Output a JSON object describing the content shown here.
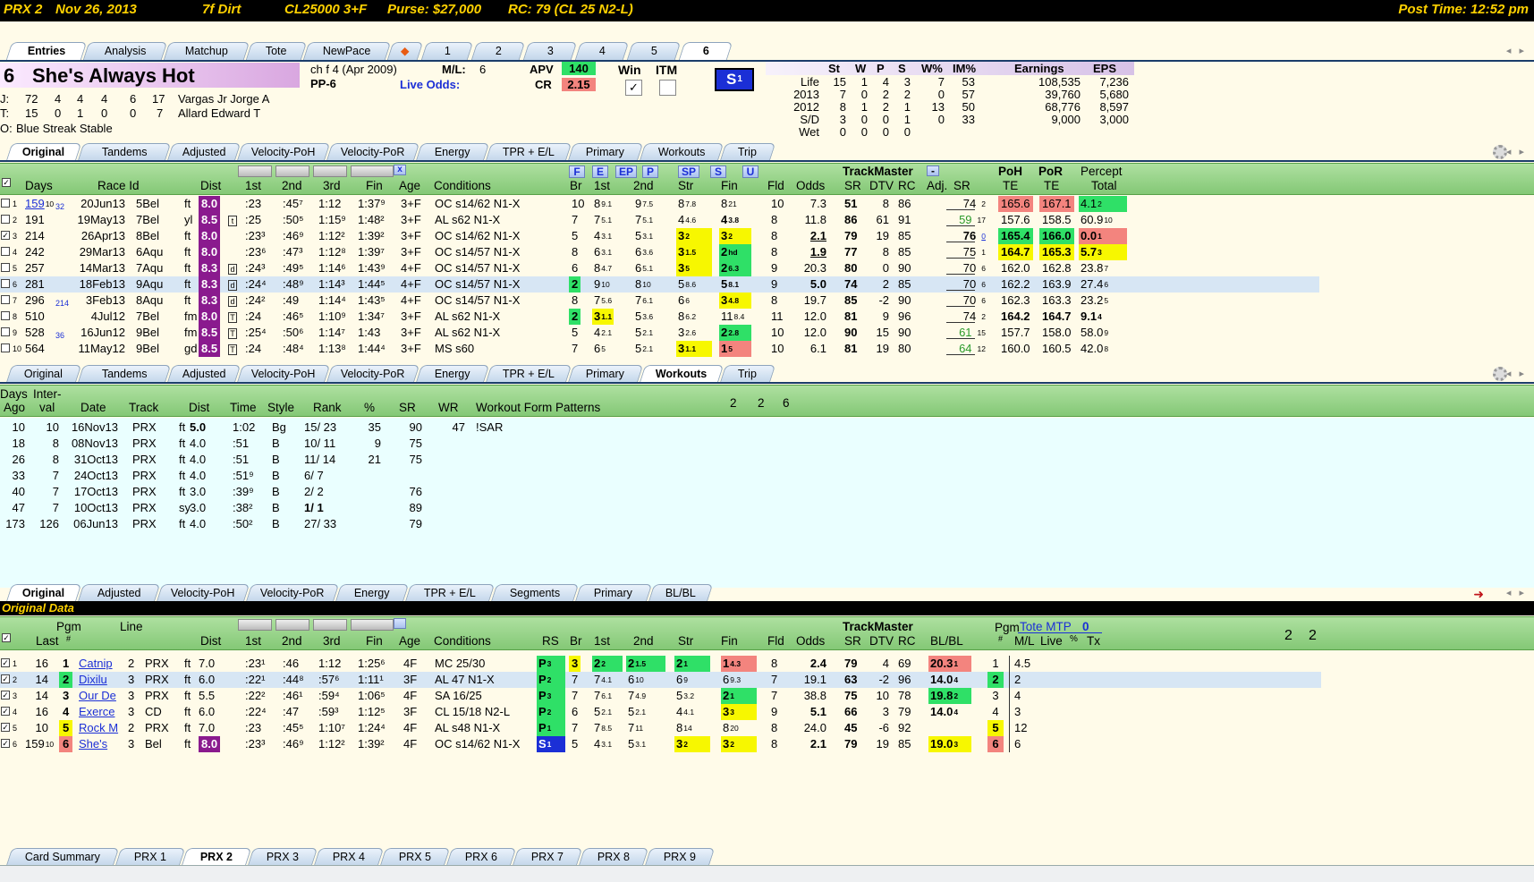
{
  "race_header": {
    "track": "PRX 2",
    "date": "Nov 26, 2013",
    "distance_surface": "7f Dirt",
    "class": "CL25000 3+F",
    "purse": "Purse: $27,000",
    "rc": "RC: 79 (CL 25 N2-L)",
    "post_time": "Post Time: 12:52 pm"
  },
  "top_tabs": [
    "Entries",
    "Analysis",
    "Matchup",
    "Tote",
    "NewPace",
    "1",
    "2",
    "3",
    "4",
    "5",
    "6"
  ],
  "horse": {
    "number": "6",
    "name": "She's Always Hot",
    "desc": "ch f 4  (Apr 2009)",
    "pp": "PP-6",
    "ml_label": "M/L:",
    "ml": "6",
    "live_odds_label": "Live Odds:",
    "apv_label": "APV",
    "apv": "140",
    "cr_label": "CR",
    "cr": "2.15",
    "win_label": "Win",
    "itm_label": "ITM",
    "badge": "S",
    "badge_sup": "1",
    "jockey": {
      "label": "J:",
      "stats": [
        "72",
        "4",
        "4",
        "4",
        "6",
        "17"
      ],
      "name": "Vargas Jr Jorge A"
    },
    "trainer": {
      "label": "T:",
      "stats": [
        "15",
        "0",
        "1",
        "0",
        "0",
        "7"
      ],
      "name": "Allard Edward T"
    },
    "owner": {
      "label": "O:",
      "name": "Blue Streak Stable"
    }
  },
  "record": {
    "headers": [
      "St",
      "W",
      "P",
      "S",
      "W%",
      "IM%",
      "Earnings",
      "EPS"
    ],
    "rows": [
      [
        "Life",
        "15",
        "1",
        "4",
        "3",
        "7",
        "53",
        "108,535",
        "7,236"
      ],
      [
        "2013",
        "7",
        "0",
        "2",
        "2",
        "0",
        "57",
        "39,760",
        "5,680"
      ],
      [
        "2012",
        "8",
        "1",
        "2",
        "1",
        "13",
        "50",
        "68,776",
        "8,597"
      ],
      [
        "S/D",
        "3",
        "0",
        "0",
        "1",
        "0",
        "33",
        "9,000",
        "3,000"
      ],
      [
        "Wet",
        "0",
        "0",
        "0",
        "0",
        "",
        "",
        "",
        ""
      ]
    ]
  },
  "pp_tabs": [
    "Original",
    "Tandems",
    "Adjusted",
    "Velocity-PoH",
    "Velocity-PoR",
    "Energy",
    "TPR + E/L",
    "Primary",
    "Workouts",
    "Trip"
  ],
  "pp_headers": {
    "days": "Days",
    "raceid": "Race Id",
    "dist": "Dist",
    "c1": "1st",
    "c2": "2nd",
    "c3": "3rd",
    "fin": "Fin",
    "age": "Age",
    "cond": "Conditions",
    "br": "Br",
    "p1": "1st",
    "p2": "2nd",
    "str": "Str",
    "pfin": "Fin",
    "fld": "Fld",
    "odds": "Odds",
    "tm": "TrackMaster",
    "sr": "SR",
    "dtv": "DTV",
    "rc": "RC",
    "adj": "Adj.",
    "adjsr": "SR",
    "poh": "PoH",
    "por": "PoR",
    "te1": "TE",
    "te2": "TE",
    "percept": "Percept",
    "total": "Total",
    "btn_f": "F",
    "btn_e": "E",
    "btn_ep": "EP",
    "btn_p": "P",
    "btn_sp": "SP",
    "btn_s": "S",
    "btn_u": "U",
    "x": "x",
    "minus": "-"
  },
  "pp_rows": [
    {
      "n": "1",
      "days": "159",
      "days_sup": "10",
      "days2": "32",
      "date": "20Jun13",
      "race": "5Bel",
      "surf": "ft",
      "dist": "8.0",
      "mark": "",
      "f1": ":23",
      "f2": ":45⁷",
      "f3": "1:12",
      "ff": "1:37⁹",
      "age": "3+F",
      "cond": "OC s14/62 N1-X",
      "br": "10",
      "p1": "8",
      "p1s": "9.1",
      "p2": "9",
      "p2s": "7.5",
      "str": "8",
      "strs": "7.8",
      "fin": "8",
      "fins": "21",
      "fld": "10",
      "odds": "7.3",
      "sr": "51",
      "dtv": "8",
      "rc": "86",
      "adj": "74",
      "adjs": "2",
      "poh": "165.6",
      "por": "167.1",
      "pct": "4.1",
      "pcts": "2"
    },
    {
      "n": "2",
      "days": "191",
      "days_sup": "",
      "days2": "",
      "date": "19May13",
      "race": "7Bel",
      "surf": "yl",
      "dist": "8.5",
      "mark": "t",
      "f1": ":25",
      "f2": ":50⁵",
      "f3": "1:15⁹",
      "ff": "1:48²",
      "age": "3+F",
      "cond": "AL s62 N1-X",
      "br": "7",
      "p1": "7",
      "p1s": "5.1",
      "p2": "7",
      "p2s": "5.1",
      "str": "4",
      "strs": "4.6",
      "fin": "4",
      "fins": "3.8",
      "fld": "8",
      "odds": "11.8",
      "sr": "86",
      "dtv": "61",
      "rc": "91",
      "adj": "59",
      "adjs": "17",
      "poh": "157.6",
      "por": "158.5",
      "pct": "60.9",
      "pcts": "10"
    },
    {
      "n": "3",
      "days": "214",
      "days_sup": "",
      "days2": "",
      "date": "26Apr13",
      "race": "8Bel",
      "surf": "ft",
      "dist": "8.0",
      "mark": "",
      "f1": ":23³",
      "f2": ":46⁹",
      "f3": "1:12²",
      "ff": "1:39²",
      "age": "3+F",
      "cond": "OC s14/62 N1-X",
      "br": "5",
      "p1": "4",
      "p1s": "3.1",
      "p2": "5",
      "p2s": "3.1",
      "str": "3",
      "strs": "2",
      "fin": "3",
      "fins": "2",
      "fld": "8",
      "odds": "2.1",
      "sr": "79",
      "dtv": "19",
      "rc": "85",
      "adj": "76",
      "adjs": "0",
      "poh": "165.4",
      "por": "166.0",
      "pct": "0.0",
      "pcts": "1"
    },
    {
      "n": "4",
      "days": "242",
      "days_sup": "",
      "days2": "",
      "date": "29Mar13",
      "race": "6Aqu",
      "surf": "ft",
      "dist": "8.0",
      "mark": "",
      "f1": ":23⁶",
      "f2": ":47³",
      "f3": "1:12⁸",
      "ff": "1:39⁷",
      "age": "3+F",
      "cond": "OC s14/57 N1-X",
      "br": "8",
      "p1": "6",
      "p1s": "3.1",
      "p2": "6",
      "p2s": "3.6",
      "str": "3",
      "strs": "1.5",
      "fin": "2",
      "fins": "hd",
      "fld": "8",
      "odds": "1.9",
      "sr": "77",
      "dtv": "8",
      "rc": "85",
      "adj": "75",
      "adjs": "1",
      "poh": "164.7",
      "por": "165.3",
      "pct": "5.7",
      "pcts": "3"
    },
    {
      "n": "5",
      "days": "257",
      "days_sup": "",
      "days2": "",
      "date": "14Mar13",
      "race": "7Aqu",
      "surf": "ft",
      "dist": "8.3",
      "mark": "d",
      "f1": ":24³",
      "f2": ":49⁵",
      "f3": "1:14⁶",
      "ff": "1:43⁹",
      "age": "4+F",
      "cond": "OC s14/57 N1-X",
      "br": "6",
      "p1": "8",
      "p1s": "4.7",
      "p2": "6",
      "p2s": "5.1",
      "str": "3",
      "strs": "5",
      "fin": "2",
      "fins": "6.3",
      "fld": "9",
      "odds": "20.3",
      "sr": "80",
      "dtv": "0",
      "rc": "90",
      "adj": "70",
      "adjs": "6",
      "poh": "162.0",
      "por": "162.8",
      "pct": "23.8",
      "pcts": "7"
    },
    {
      "n": "6",
      "days": "281",
      "days_sup": "",
      "days2": "",
      "date": "18Feb13",
      "race": "9Aqu",
      "surf": "ft",
      "dist": "8.3",
      "mark": "d",
      "f1": ":24⁴",
      "f2": ":48⁹",
      "f3": "1:14³",
      "ff": "1:44⁵",
      "age": "4+F",
      "cond": "OC s14/57 N1-X",
      "br": "2",
      "p1": "9",
      "p1s": "10",
      "p2": "8",
      "p2s": "10",
      "str": "5",
      "strs": "8.6",
      "fin": "5",
      "fins": "8.1",
      "fld": "9",
      "odds": "5.0",
      "sr": "74",
      "dtv": "2",
      "rc": "85",
      "adj": "70",
      "adjs": "6",
      "poh": "162.2",
      "por": "163.9",
      "pct": "27.4",
      "pcts": "6"
    },
    {
      "n": "7",
      "days": "296",
      "days_sup": "",
      "days2": "214",
      "date": "3Feb13",
      "race": "8Aqu",
      "surf": "ft",
      "dist": "8.3",
      "mark": "d",
      "f1": ":24²",
      "f2": ":49",
      "f3": "1:14⁴",
      "ff": "1:43⁵",
      "age": "4+F",
      "cond": "OC s14/57 N1-X",
      "br": "8",
      "p1": "7",
      "p1s": "5.6",
      "p2": "7",
      "p2s": "6.1",
      "str": "6",
      "strs": "6",
      "fin": "3",
      "fins": "4.8",
      "fld": "8",
      "odds": "19.7",
      "sr": "85",
      "dtv": "-2",
      "rc": "90",
      "adj": "70",
      "adjs": "6",
      "poh": "162.3",
      "por": "163.3",
      "pct": "23.2",
      "pcts": "5"
    },
    {
      "n": "8",
      "days": "510",
      "days_sup": "",
      "days2": "",
      "date": "4Jul12",
      "race": "7Bel",
      "surf": "fm",
      "dist": "8.0",
      "mark": "T",
      "f1": ":24",
      "f2": ":46⁵",
      "f3": "1:10⁹",
      "ff": "1:34⁷",
      "age": "3+F",
      "cond": "AL s62 N1-X",
      "br": "2",
      "p1": "3",
      "p1s": "1.1",
      "p2": "5",
      "p2s": "3.6",
      "str": "8",
      "strs": "6.2",
      "fin": "11",
      "fins": "8.4",
      "fld": "11",
      "odds": "12.0",
      "sr": "81",
      "dtv": "9",
      "rc": "96",
      "adj": "74",
      "adjs": "2",
      "poh": "164.2",
      "por": "164.7",
      "pct": "9.1",
      "pcts": "4"
    },
    {
      "n": "9",
      "days": "528",
      "days_sup": "",
      "days2": "36",
      "date": "16Jun12",
      "race": "9Bel",
      "surf": "fm",
      "dist": "8.5",
      "mark": "T",
      "f1": ":25⁴",
      "f2": ":50⁶",
      "f3": "1:14⁷",
      "ff": "1:43",
      "age": "3+F",
      "cond": "AL s62 N1-X",
      "br": "5",
      "p1": "4",
      "p1s": "2.1",
      "p2": "5",
      "p2s": "2.1",
      "str": "3",
      "strs": "2.6",
      "fin": "2",
      "fins": "2.8",
      "fld": "10",
      "odds": "12.0",
      "sr": "90",
      "dtv": "15",
      "rc": "90",
      "adj": "61",
      "adjs": "15",
      "poh": "157.7",
      "por": "158.0",
      "pct": "58.0",
      "pcts": "9"
    },
    {
      "n": "10",
      "days": "564",
      "days_sup": "",
      "days2": "",
      "date": "11May12",
      "race": "9Bel",
      "surf": "gd",
      "dist": "8.5",
      "mark": "T",
      "f1": ":24",
      "f2": ":48⁴",
      "f3": "1:13⁸",
      "ff": "1:44⁴",
      "age": "3+F",
      "cond": "MS s60",
      "br": "7",
      "p1": "6",
      "p1s": "5",
      "p2": "5",
      "p2s": "2.1",
      "str": "3",
      "strs": "1.1",
      "fin": "1",
      "fins": "5",
      "fld": "10",
      "odds": "6.1",
      "sr": "81",
      "dtv": "19",
      "rc": "80",
      "adj": "64",
      "adjs": "12",
      "poh": "160.0",
      "por": "160.5",
      "pct": "42.0",
      "pcts": "8"
    }
  ],
  "workout_tabs": [
    "Original",
    "Tandems",
    "Adjusted",
    "Velocity-PoH",
    "Velocity-PoR",
    "Energy",
    "TPR + E/L",
    "Primary",
    "Workouts",
    "Trip"
  ],
  "workout_headers": {
    "days": "Days",
    "ago": "Ago",
    "inter": "Inter-",
    "val": "val",
    "date": "Date",
    "track": "Track",
    "dist": "Dist",
    "time": "Time",
    "style": "Style",
    "rank": "Rank",
    "pct": "%",
    "sr": "SR",
    "wr": "WR",
    "patterns": "Workout Form Patterns",
    "n1": "2",
    "n2": "2",
    "n3": "6"
  },
  "workouts": [
    [
      "10",
      "10",
      "16Nov13",
      "PRX",
      "ft",
      "5.0",
      "1:02",
      "Bg",
      "15/ 23",
      "35",
      "90",
      "47",
      "!SAR"
    ],
    [
      "18",
      "8",
      "08Nov13",
      "PRX",
      "ft",
      "4.0",
      ":51",
      "B",
      "10/ 11",
      "9",
      "75",
      "",
      ""
    ],
    [
      "26",
      "8",
      "31Oct13",
      "PRX",
      "ft",
      "4.0",
      ":51",
      "B",
      "11/ 14",
      "21",
      "75",
      "",
      ""
    ],
    [
      "33",
      "7",
      "24Oct13",
      "PRX",
      "ft",
      "4.0",
      ":51⁹",
      "B",
      "6/ 7",
      "",
      "",
      "",
      ""
    ],
    [
      "40",
      "7",
      "17Oct13",
      "PRX",
      "ft",
      "3.0",
      ":39⁹",
      "B",
      "2/ 2",
      "",
      "76",
      "",
      ""
    ],
    [
      "47",
      "7",
      "10Oct13",
      "PRX",
      "sy",
      "3.0",
      ":38²",
      "B",
      "1/ 1",
      "",
      "89",
      "",
      ""
    ],
    [
      "173",
      "126",
      "06Jun13",
      "PRX",
      "ft",
      "4.0",
      ":50²",
      "B",
      "27/ 33",
      "",
      "79",
      "",
      ""
    ]
  ],
  "field_tabs": [
    "Original",
    "Adjusted",
    "Velocity-PoH",
    "Velocity-PoR",
    "Energy",
    "TPR + E/L",
    "Segments",
    "Primary",
    "BL/BL"
  ],
  "field_title": "Original Data",
  "field_headers": {
    "last": "Last",
    "pgm": "Pgm",
    "pgm2": "#",
    "line": "Line",
    "dist": "Dist",
    "c1": "1st",
    "c2": "2nd",
    "c3": "3rd",
    "fin": "Fin",
    "age": "Age",
    "cond": "Conditions",
    "rs": "RS",
    "br": "Br",
    "p1": "1st",
    "p2": "2nd",
    "str": "Str",
    "pfin": "Fin",
    "fld": "Fld",
    "odds": "Odds",
    "tm": "TrackMaster",
    "sr": "SR",
    "dtv": "DTV",
    "rc": "RC",
    "blbl": "BL/BL",
    "pgm3": "Pgm",
    "pgm4": "#",
    "tote": "Tote MTP",
    "tote_val": "0",
    "ml": "M/L",
    "live": "Live",
    "pctx": "%",
    "tx": "Tx",
    "n1": "2",
    "n2": "2"
  },
  "field_rows": [
    {
      "n": "1",
      "last": "16",
      "pgm": "1",
      "name": "Catnip",
      "line": "2",
      "trk": "PRX",
      "surf": "ft",
      "dist": "7.0",
      "f1": ":23¹",
      "f2": ":46",
      "f3": "1:12",
      "ff": "1:25⁶",
      "age": "4F",
      "cond": "MC 25/30",
      "rs": "P",
      "rss": "3",
      "br": "3",
      "p1": "2",
      "p1s": "2",
      "p2": "2",
      "p2s": "1.5",
      "str": "2",
      "strs": "1",
      "fin": "1",
      "fins": "4.3",
      "fld": "8",
      "odds": "2.4",
      "sr": "79",
      "dtv": "4",
      "rc": "69",
      "bl": "20.3",
      "bls": "1",
      "pgm2": "1",
      "ml": "4.5"
    },
    {
      "n": "2",
      "last": "14",
      "pgm": "2",
      "name": "Dixilu",
      "line": "3",
      "trk": "PRX",
      "surf": "ft",
      "dist": "6.0",
      "f1": ":22¹",
      "f2": ":44⁸",
      "f3": ":57⁶",
      "ff": "1:11¹",
      "age": "3F",
      "cond": "AL 47 N1-X",
      "rs": "P",
      "rss": "2",
      "br": "7",
      "p1": "7",
      "p1s": "4.1",
      "p2": "6",
      "p2s": "10",
      "str": "6",
      "strs": "9",
      "fin": "6",
      "fins": "9.3",
      "fld": "7",
      "odds": "19.1",
      "sr": "63",
      "dtv": "-2",
      "rc": "96",
      "bl": "14.0",
      "bls": "4",
      "pgm2": "2",
      "ml": "2"
    },
    {
      "n": "3",
      "last": "14",
      "pgm": "3",
      "name": "Our De",
      "line": "3",
      "trk": "PRX",
      "surf": "ft",
      "dist": "5.5",
      "f1": ":22²",
      "f2": ":46¹",
      "f3": ":59⁴",
      "ff": "1:06⁵",
      "age": "4F",
      "cond": "SA 16/25",
      "rs": "P",
      "rss": "3",
      "br": "7",
      "p1": "7",
      "p1s": "6.1",
      "p2": "7",
      "p2s": "4.9",
      "str": "5",
      "strs": "3.2",
      "fin": "2",
      "fins": "1",
      "fld": "7",
      "odds": "38.8",
      "sr": "75",
      "dtv": "10",
      "rc": "78",
      "bl": "19.8",
      "bls": "2",
      "pgm2": "3",
      "ml": "4"
    },
    {
      "n": "4",
      "last": "16",
      "pgm": "4",
      "name": "Exerce",
      "line": "3",
      "trk": "CD",
      "surf": "ft",
      "dist": "6.0",
      "f1": ":22⁴",
      "f2": ":47",
      "f3": ":59³",
      "ff": "1:12⁵",
      "age": "3F",
      "cond": "CL 15/18 N2-L",
      "rs": "P",
      "rss": "2",
      "br": "6",
      "p1": "5",
      "p1s": "2.1",
      "p2": "5",
      "p2s": "2.1",
      "str": "4",
      "strs": "4.1",
      "fin": "3",
      "fins": "3",
      "fld": "9",
      "odds": "5.1",
      "sr": "66",
      "dtv": "3",
      "rc": "79",
      "bl": "14.0",
      "bls": "4",
      "pgm2": "4",
      "ml": "3"
    },
    {
      "n": "5",
      "last": "10",
      "pgm": "5",
      "name": "Rock M",
      "line": "2",
      "trk": "PRX",
      "surf": "ft",
      "dist": "7.0",
      "f1": ":23",
      "f2": ":45⁵",
      "f3": "1:10⁷",
      "ff": "1:24⁴",
      "age": "4F",
      "cond": "AL s48 N1-X",
      "rs": "P",
      "rss": "1",
      "br": "7",
      "p1": "7",
      "p1s": "8.5",
      "p2": "7",
      "p2s": "11",
      "str": "8",
      "strs": "14",
      "fin": "8",
      "fins": "20",
      "fld": "8",
      "odds": "24.0",
      "sr": "45",
      "dtv": "-6",
      "rc": "92",
      "bl": "",
      "bls": "",
      "pgm2": "5",
      "ml": "12"
    },
    {
      "n": "6",
      "last": "159",
      "lasts": "10",
      "pgm": "6",
      "name": "She's",
      "line": "3",
      "trk": "Bel",
      "surf": "ft",
      "dist": "8.0",
      "f1": ":23³",
      "f2": ":46⁹",
      "f3": "1:12²",
      "ff": "1:39²",
      "age": "4F",
      "cond": "OC s14/62 N1-X",
      "rs": "S",
      "rss": "1",
      "br": "5",
      "p1": "4",
      "p1s": "3.1",
      "p2": "5",
      "p2s": "3.1",
      "str": "3",
      "strs": "2",
      "fin": "3",
      "fins": "2",
      "fld": "8",
      "odds": "2.1",
      "sr": "79",
      "dtv": "19",
      "rc": "85",
      "bl": "19.0",
      "bls": "3",
      "pgm2": "6",
      "ml": "6"
    }
  ],
  "bottom_tabs": [
    "Card Summary",
    "PRX 1",
    "PRX 2",
    "PRX 3",
    "PRX 4",
    "PRX 5",
    "PRX 6",
    "PRX 7",
    "PRX 8",
    "PRX 9"
  ],
  "colors": {
    "green_header": "#95d486",
    "pp_purple": "#8a1a8e",
    "highlight_red": "#f3847e",
    "highlight_green": "#2fe067",
    "highlight_yellow": "#f7f700",
    "link_blue": "#1b2fd6"
  }
}
